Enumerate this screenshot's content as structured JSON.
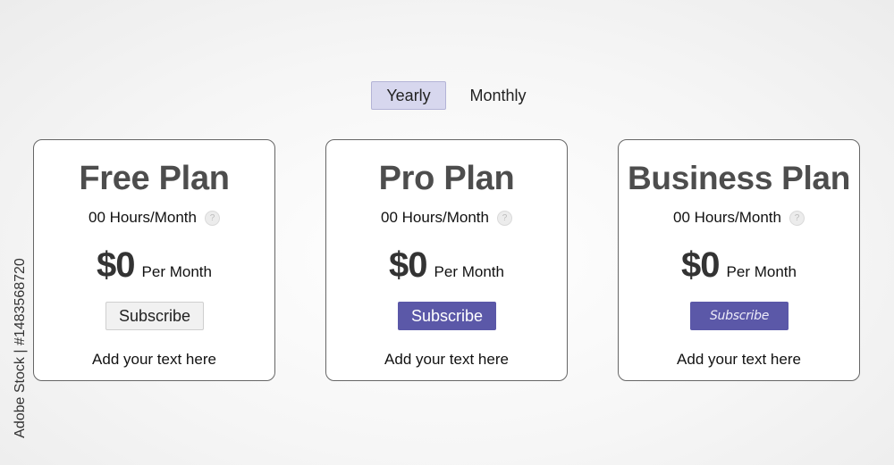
{
  "billing_toggle": {
    "options": [
      "Yearly",
      "Monthly"
    ],
    "selected": "Yearly"
  },
  "plans": [
    {
      "title": "Free Plan",
      "hours": "00 Hours/Month",
      "help_icon": "question-circle-icon",
      "price": "$0",
      "period": "Per Month",
      "button_label": "Subscribe",
      "button_style": "light",
      "footer": "Add your text here"
    },
    {
      "title": "Pro Plan",
      "hours": "00 Hours/Month",
      "help_icon": "question-circle-icon",
      "price": "$0",
      "period": "Per Month",
      "button_label": "Subscribe",
      "button_style": "primary",
      "footer": "Add your text here"
    },
    {
      "title": "Business Plan",
      "hours": "00 Hours/Month",
      "help_icon": "question-circle-icon",
      "price": "$0",
      "period": "Per Month",
      "button_label": "Subscribe",
      "button_style": "primary-italic",
      "footer": "Add your text here"
    }
  ],
  "watermark": {
    "side_text": "Adobe Stock | #1483568720"
  },
  "colors": {
    "accent": "#5b58a8",
    "toggle_active_bg": "#d7d7ee",
    "title_text": "#4d4d4d",
    "card_border": "#666666"
  }
}
